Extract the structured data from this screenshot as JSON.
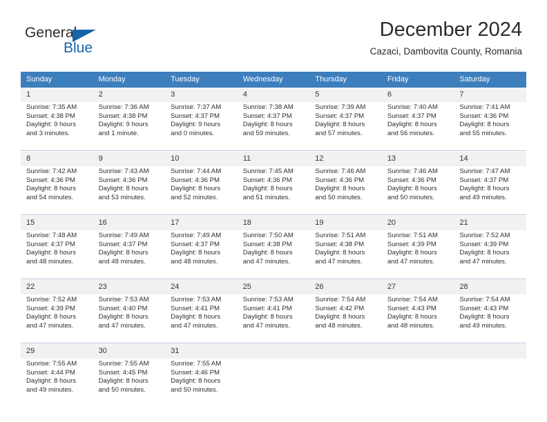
{
  "logo": {
    "line1": "General",
    "line2": "Blue",
    "accent_color": "#1565a8",
    "triangle_icon": "triangle-icon"
  },
  "header": {
    "month_title": "December 2024",
    "location": "Cazaci, Dambovita County, Romania"
  },
  "calendar": {
    "header_bg": "#3d7ebd",
    "daynum_bg": "#f1f1f1",
    "weekdays": [
      "Sunday",
      "Monday",
      "Tuesday",
      "Wednesday",
      "Thursday",
      "Friday",
      "Saturday"
    ],
    "weeks": [
      [
        {
          "day": "1",
          "sunrise": "Sunrise: 7:35 AM",
          "sunset": "Sunset: 4:38 PM",
          "daylight1": "Daylight: 9 hours",
          "daylight2": "and 3 minutes."
        },
        {
          "day": "2",
          "sunrise": "Sunrise: 7:36 AM",
          "sunset": "Sunset: 4:38 PM",
          "daylight1": "Daylight: 9 hours",
          "daylight2": "and 1 minute."
        },
        {
          "day": "3",
          "sunrise": "Sunrise: 7:37 AM",
          "sunset": "Sunset: 4:37 PM",
          "daylight1": "Daylight: 9 hours",
          "daylight2": "and 0 minutes."
        },
        {
          "day": "4",
          "sunrise": "Sunrise: 7:38 AM",
          "sunset": "Sunset: 4:37 PM",
          "daylight1": "Daylight: 8 hours",
          "daylight2": "and 59 minutes."
        },
        {
          "day": "5",
          "sunrise": "Sunrise: 7:39 AM",
          "sunset": "Sunset: 4:37 PM",
          "daylight1": "Daylight: 8 hours",
          "daylight2": "and 57 minutes."
        },
        {
          "day": "6",
          "sunrise": "Sunrise: 7:40 AM",
          "sunset": "Sunset: 4:37 PM",
          "daylight1": "Daylight: 8 hours",
          "daylight2": "and 56 minutes."
        },
        {
          "day": "7",
          "sunrise": "Sunrise: 7:41 AM",
          "sunset": "Sunset: 4:36 PM",
          "daylight1": "Daylight: 8 hours",
          "daylight2": "and 55 minutes."
        }
      ],
      [
        {
          "day": "8",
          "sunrise": "Sunrise: 7:42 AM",
          "sunset": "Sunset: 4:36 PM",
          "daylight1": "Daylight: 8 hours",
          "daylight2": "and 54 minutes."
        },
        {
          "day": "9",
          "sunrise": "Sunrise: 7:43 AM",
          "sunset": "Sunset: 4:36 PM",
          "daylight1": "Daylight: 8 hours",
          "daylight2": "and 53 minutes."
        },
        {
          "day": "10",
          "sunrise": "Sunrise: 7:44 AM",
          "sunset": "Sunset: 4:36 PM",
          "daylight1": "Daylight: 8 hours",
          "daylight2": "and 52 minutes."
        },
        {
          "day": "11",
          "sunrise": "Sunrise: 7:45 AM",
          "sunset": "Sunset: 4:36 PM",
          "daylight1": "Daylight: 8 hours",
          "daylight2": "and 51 minutes."
        },
        {
          "day": "12",
          "sunrise": "Sunrise: 7:46 AM",
          "sunset": "Sunset: 4:36 PM",
          "daylight1": "Daylight: 8 hours",
          "daylight2": "and 50 minutes."
        },
        {
          "day": "13",
          "sunrise": "Sunrise: 7:46 AM",
          "sunset": "Sunset: 4:36 PM",
          "daylight1": "Daylight: 8 hours",
          "daylight2": "and 50 minutes."
        },
        {
          "day": "14",
          "sunrise": "Sunrise: 7:47 AM",
          "sunset": "Sunset: 4:37 PM",
          "daylight1": "Daylight: 8 hours",
          "daylight2": "and 49 minutes."
        }
      ],
      [
        {
          "day": "15",
          "sunrise": "Sunrise: 7:48 AM",
          "sunset": "Sunset: 4:37 PM",
          "daylight1": "Daylight: 8 hours",
          "daylight2": "and 48 minutes."
        },
        {
          "day": "16",
          "sunrise": "Sunrise: 7:49 AM",
          "sunset": "Sunset: 4:37 PM",
          "daylight1": "Daylight: 8 hours",
          "daylight2": "and 48 minutes."
        },
        {
          "day": "17",
          "sunrise": "Sunrise: 7:49 AM",
          "sunset": "Sunset: 4:37 PM",
          "daylight1": "Daylight: 8 hours",
          "daylight2": "and 48 minutes."
        },
        {
          "day": "18",
          "sunrise": "Sunrise: 7:50 AM",
          "sunset": "Sunset: 4:38 PM",
          "daylight1": "Daylight: 8 hours",
          "daylight2": "and 47 minutes."
        },
        {
          "day": "19",
          "sunrise": "Sunrise: 7:51 AM",
          "sunset": "Sunset: 4:38 PM",
          "daylight1": "Daylight: 8 hours",
          "daylight2": "and 47 minutes."
        },
        {
          "day": "20",
          "sunrise": "Sunrise: 7:51 AM",
          "sunset": "Sunset: 4:39 PM",
          "daylight1": "Daylight: 8 hours",
          "daylight2": "and 47 minutes."
        },
        {
          "day": "21",
          "sunrise": "Sunrise: 7:52 AM",
          "sunset": "Sunset: 4:39 PM",
          "daylight1": "Daylight: 8 hours",
          "daylight2": "and 47 minutes."
        }
      ],
      [
        {
          "day": "22",
          "sunrise": "Sunrise: 7:52 AM",
          "sunset": "Sunset: 4:39 PM",
          "daylight1": "Daylight: 8 hours",
          "daylight2": "and 47 minutes."
        },
        {
          "day": "23",
          "sunrise": "Sunrise: 7:53 AM",
          "sunset": "Sunset: 4:40 PM",
          "daylight1": "Daylight: 8 hours",
          "daylight2": "and 47 minutes."
        },
        {
          "day": "24",
          "sunrise": "Sunrise: 7:53 AM",
          "sunset": "Sunset: 4:41 PM",
          "daylight1": "Daylight: 8 hours",
          "daylight2": "and 47 minutes."
        },
        {
          "day": "25",
          "sunrise": "Sunrise: 7:53 AM",
          "sunset": "Sunset: 4:41 PM",
          "daylight1": "Daylight: 8 hours",
          "daylight2": "and 47 minutes."
        },
        {
          "day": "26",
          "sunrise": "Sunrise: 7:54 AM",
          "sunset": "Sunset: 4:42 PM",
          "daylight1": "Daylight: 8 hours",
          "daylight2": "and 48 minutes."
        },
        {
          "day": "27",
          "sunrise": "Sunrise: 7:54 AM",
          "sunset": "Sunset: 4:43 PM",
          "daylight1": "Daylight: 8 hours",
          "daylight2": "and 48 minutes."
        },
        {
          "day": "28",
          "sunrise": "Sunrise: 7:54 AM",
          "sunset": "Sunset: 4:43 PM",
          "daylight1": "Daylight: 8 hours",
          "daylight2": "and 49 minutes."
        }
      ],
      [
        {
          "day": "29",
          "sunrise": "Sunrise: 7:55 AM",
          "sunset": "Sunset: 4:44 PM",
          "daylight1": "Daylight: 8 hours",
          "daylight2": "and 49 minutes."
        },
        {
          "day": "30",
          "sunrise": "Sunrise: 7:55 AM",
          "sunset": "Sunset: 4:45 PM",
          "daylight1": "Daylight: 8 hours",
          "daylight2": "and 50 minutes."
        },
        {
          "day": "31",
          "sunrise": "Sunrise: 7:55 AM",
          "sunset": "Sunset: 4:46 PM",
          "daylight1": "Daylight: 8 hours",
          "daylight2": "and 50 minutes."
        },
        {
          "day": "",
          "sunrise": "",
          "sunset": "",
          "daylight1": "",
          "daylight2": ""
        },
        {
          "day": "",
          "sunrise": "",
          "sunset": "",
          "daylight1": "",
          "daylight2": ""
        },
        {
          "day": "",
          "sunrise": "",
          "sunset": "",
          "daylight1": "",
          "daylight2": ""
        },
        {
          "day": "",
          "sunrise": "",
          "sunset": "",
          "daylight1": "",
          "daylight2": ""
        }
      ]
    ]
  }
}
